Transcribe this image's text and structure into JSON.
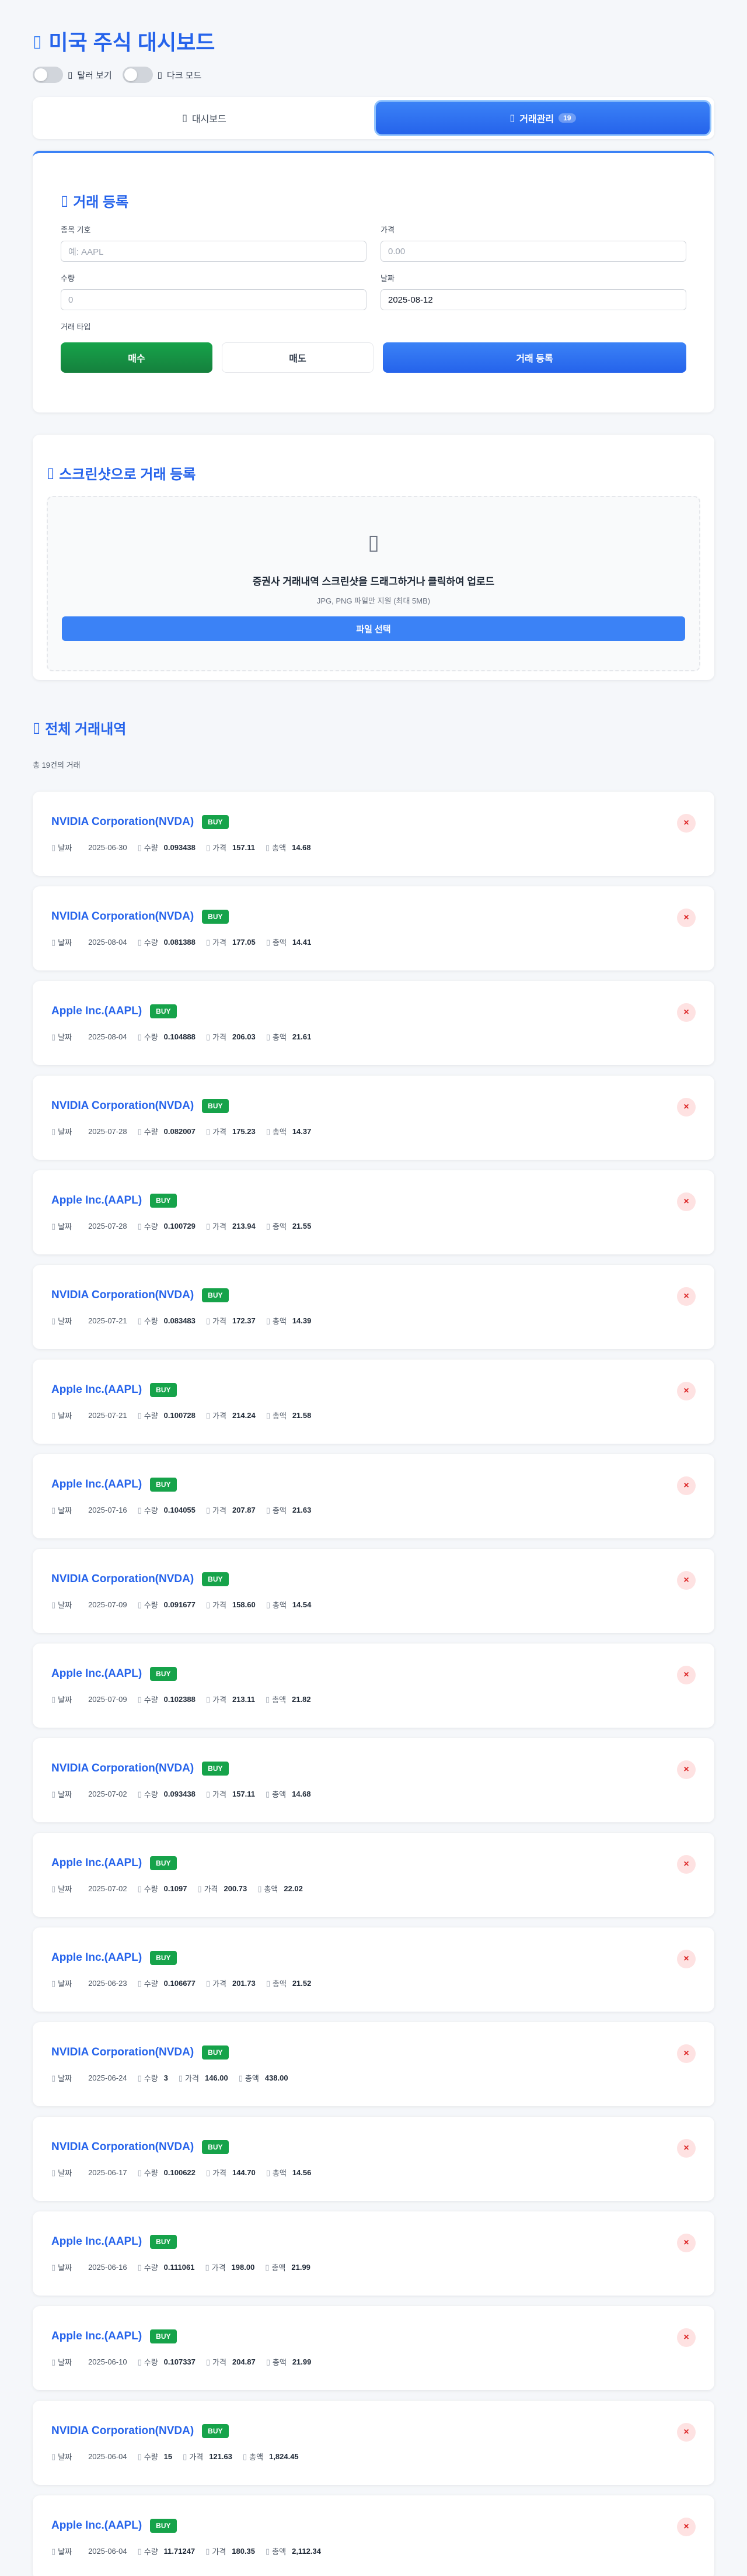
{
  "header": {
    "title_icon": "chart-icon",
    "title": "미국 주식 대시보드",
    "dollar_toggle_label": "달러 보기",
    "dark_toggle_label": "다크 모드"
  },
  "tabs": [
    {
      "label": "대시보드",
      "icon": "chart-icon",
      "active": false
    },
    {
      "label": "거래관리",
      "icon": "memo-icon",
      "active": true,
      "badge": "19"
    }
  ],
  "form": {
    "title": "거래 등록",
    "symbol_label": "종목 기호",
    "symbol_placeholder": "예: AAPL",
    "price_label": "가격",
    "price_placeholder": "0.00",
    "qty_label": "수량",
    "qty_placeholder": "0",
    "date_label": "날짜",
    "date_value": "2025-08-12",
    "type_label": "거래 타입",
    "buy_label": "매수",
    "sell_label": "매도",
    "submit_label": "거래 등록"
  },
  "upload": {
    "title": "스크린샷으로 거래 등록",
    "main_text": "증권사 거래내역 스크린샷을 드래그하거나 클릭하여 업로드",
    "sub_text": "JPG, PNG 파일만 지원 (최대 5MB)",
    "button_label": "파일 선택"
  },
  "history": {
    "title": "전체 거래내역",
    "count_text": "총 19건의 거래",
    "labels": {
      "date": "날짜",
      "qty": "수량",
      "price": "가격",
      "total": "총액"
    },
    "delete_label": "×",
    "transactions": [
      {
        "name": "NVIDIA Corporation(NVDA)",
        "type": "BUY",
        "date": "2025-06-30",
        "qty": "0.093438",
        "price": "157.11",
        "total": "14.68"
      },
      {
        "name": "NVIDIA Corporation(NVDA)",
        "type": "BUY",
        "date": "2025-08-04",
        "qty": "0.081388",
        "price": "177.05",
        "total": "14.41"
      },
      {
        "name": "Apple Inc.(AAPL)",
        "type": "BUY",
        "date": "2025-08-04",
        "qty": "0.104888",
        "price": "206.03",
        "total": "21.61"
      },
      {
        "name": "NVIDIA Corporation(NVDA)",
        "type": "BUY",
        "date": "2025-07-28",
        "qty": "0.082007",
        "price": "175.23",
        "total": "14.37"
      },
      {
        "name": "Apple Inc.(AAPL)",
        "type": "BUY",
        "date": "2025-07-28",
        "qty": "0.100729",
        "price": "213.94",
        "total": "21.55"
      },
      {
        "name": "NVIDIA Corporation(NVDA)",
        "type": "BUY",
        "date": "2025-07-21",
        "qty": "0.083483",
        "price": "172.37",
        "total": "14.39"
      },
      {
        "name": "Apple Inc.(AAPL)",
        "type": "BUY",
        "date": "2025-07-21",
        "qty": "0.100728",
        "price": "214.24",
        "total": "21.58"
      },
      {
        "name": "Apple Inc.(AAPL)",
        "type": "BUY",
        "date": "2025-07-16",
        "qty": "0.104055",
        "price": "207.87",
        "total": "21.63"
      },
      {
        "name": "NVIDIA Corporation(NVDA)",
        "type": "BUY",
        "date": "2025-07-09",
        "qty": "0.091677",
        "price": "158.60",
        "total": "14.54"
      },
      {
        "name": "Apple Inc.(AAPL)",
        "type": "BUY",
        "date": "2025-07-09",
        "qty": "0.102388",
        "price": "213.11",
        "total": "21.82"
      },
      {
        "name": "NVIDIA Corporation(NVDA)",
        "type": "BUY",
        "date": "2025-07-02",
        "qty": "0.093438",
        "price": "157.11",
        "total": "14.68"
      },
      {
        "name": "Apple Inc.(AAPL)",
        "type": "BUY",
        "date": "2025-07-02",
        "qty": "0.1097",
        "price": "200.73",
        "total": "22.02"
      },
      {
        "name": "Apple Inc.(AAPL)",
        "type": "BUY",
        "date": "2025-06-23",
        "qty": "0.106677",
        "price": "201.73",
        "total": "21.52"
      },
      {
        "name": "NVIDIA Corporation(NVDA)",
        "type": "BUY",
        "date": "2025-06-24",
        "qty": "3",
        "price": "146.00",
        "total": "438.00"
      },
      {
        "name": "NVIDIA Corporation(NVDA)",
        "type": "BUY",
        "date": "2025-06-17",
        "qty": "0.100622",
        "price": "144.70",
        "total": "14.56"
      },
      {
        "name": "Apple Inc.(AAPL)",
        "type": "BUY",
        "date": "2025-06-16",
        "qty": "0.111061",
        "price": "198.00",
        "total": "21.99"
      },
      {
        "name": "Apple Inc.(AAPL)",
        "type": "BUY",
        "date": "2025-06-10",
        "qty": "0.107337",
        "price": "204.87",
        "total": "21.99"
      },
      {
        "name": "NVIDIA Corporation(NVDA)",
        "type": "BUY",
        "date": "2025-06-04",
        "qty": "15",
        "price": "121.63",
        "total": "1,824.45"
      },
      {
        "name": "Apple Inc.(AAPL)",
        "type": "BUY",
        "date": "2025-06-04",
        "qty": "11.71247",
        "price": "180.35",
        "total": "2,112.34"
      }
    ]
  }
}
